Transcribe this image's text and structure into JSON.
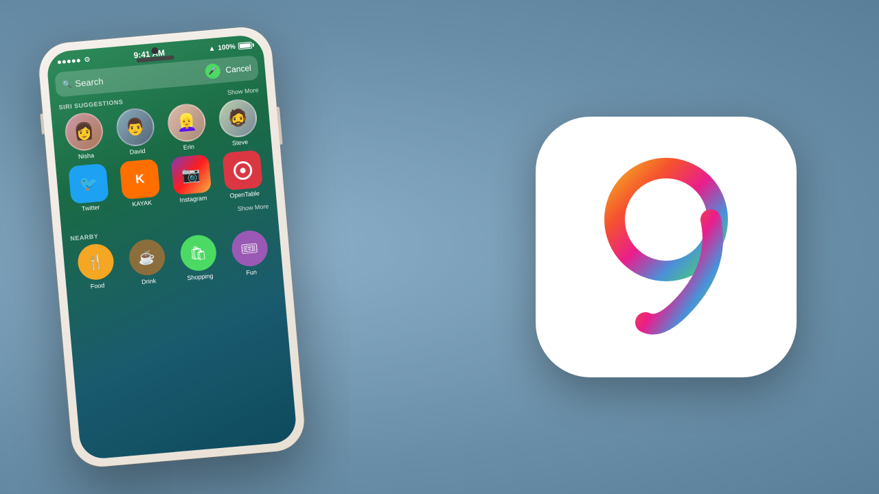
{
  "background": {
    "color": "#7a9bb5"
  },
  "status_bar": {
    "dots": 5,
    "wifi_icon": "wifi",
    "time": "9:41 AM",
    "location_icon": "▲",
    "battery_percent": "100%",
    "battery_icon": "battery"
  },
  "search": {
    "placeholder": "Search",
    "cancel_label": "Cancel",
    "mic_icon": "mic"
  },
  "siri_suggestions": {
    "title": "SIRI SUGGESTIONS",
    "show_more": "Show More",
    "contacts": [
      {
        "name": "Nisha",
        "emoji": "👩"
      },
      {
        "name": "David",
        "emoji": "👨"
      },
      {
        "name": "Erin",
        "emoji": "👱‍♀️"
      },
      {
        "name": "Steve",
        "emoji": "🧔"
      }
    ],
    "apps": [
      {
        "name": "Twitter",
        "icon": "🐦",
        "color_class": "twitter-color"
      },
      {
        "name": "KAYAK",
        "icon": "K",
        "color_class": "kayak-color"
      },
      {
        "name": "Instagram",
        "icon": "📷",
        "color_class": "instagram-color"
      },
      {
        "name": "OpenTable",
        "icon": "⚪",
        "color_class": "opentable-color"
      }
    ],
    "apps_show_more": "Show More"
  },
  "nearby": {
    "title": "NEARBY",
    "items": [
      {
        "name": "Food",
        "icon": "🍴",
        "color_class": "food-color"
      },
      {
        "name": "Drink",
        "icon": "☕",
        "color_class": "drink-color"
      },
      {
        "name": "Shopping",
        "icon": "🛍",
        "color_class": "shopping-color"
      },
      {
        "name": "Fun",
        "icon": "🎟",
        "color_class": "fun-color"
      }
    ]
  },
  "ios9_icon": {
    "label": "iOS 9"
  }
}
